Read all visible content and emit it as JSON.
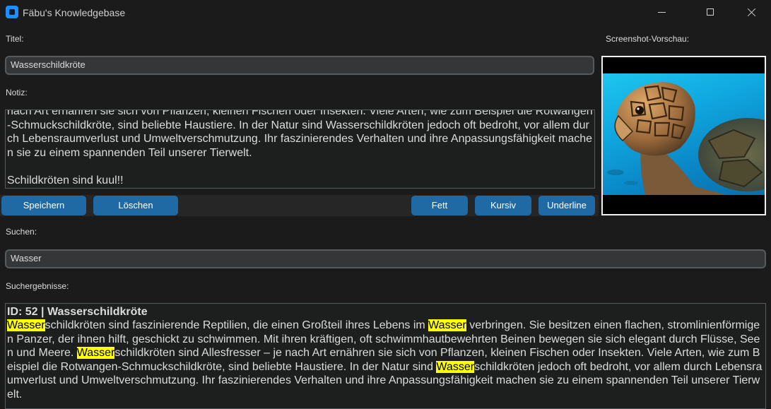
{
  "window": {
    "title": "Fäbu's Knowledgebase"
  },
  "labels": {
    "title": "Titel:",
    "note": "Notiz:",
    "preview": "Screenshot-Vorschau:",
    "search": "Suchen:",
    "results": "Suchergebnisse:"
  },
  "title_input": {
    "value": "Wasserschildkröte"
  },
  "note": {
    "paragraph": "nach Art ernähren sie sich von Pflanzen, kleinen Fischen oder Insekten. Viele Arten, wie zum Beispiel die Rotwangen-Schmuckschildkröte, sind beliebte Haustiere. In der Natur sind Wasserschildkröten jedoch oft bedroht, vor allem durch Lebensraumverlust und Umweltverschmutzung. Ihr faszinierendes Verhalten und ihre Anpassungsfähigkeit machen sie zu einem spannenden Teil unserer Tierwelt.",
    "closing": "Schildkröten sind kuul!!"
  },
  "buttons": {
    "save": "Speichern",
    "delete": "Löschen",
    "bold": "Fett",
    "italic": "Kursiv",
    "underline": "Underline"
  },
  "search_input": {
    "value": "Wasser"
  },
  "result": {
    "header": "ID: 52 | Wasserschildkröte",
    "parts": [
      {
        "hit": "Wasser",
        "text": "schildkröten sind faszinierende Reptilien, die einen Großteil ihres Lebens im "
      },
      {
        "hit": "Wasser",
        "text": " verbringen. Sie besitzen einen flachen, stromlinienförmigen Panzer, der ihnen hilft, geschickt zu schwimmen. Mit ihren kräftigen, oft schwimmhautbewehrten Beinen bewegen sie sich elegant durch Flüsse, Seen und Meere. "
      },
      {
        "hit": "Wasser",
        "text": "schildkröten sind Allesfresser – je nach Art ernähren sie sich von Pflanzen, kleinen Fischen oder Insekten. Viele Arten, wie zum Beispiel die Rotwangen-Schmuckschildkröte, sind beliebte Haustiere. In der Natur sind "
      },
      {
        "hit": "Wasser",
        "text": "schildkröten jedoch oft bedroht, vor allem durch Lebensraumverlust und Umweltverschmutzung. Ihr faszinierendes Verhalten und ihre Anpassungsfähigkeit machen sie zu einem spannenden Teil unserer Tierwelt."
      }
    ]
  },
  "colors": {
    "accent": "#1f6aa5",
    "highlight": "#ffff00",
    "background": "#1b1b1b"
  }
}
